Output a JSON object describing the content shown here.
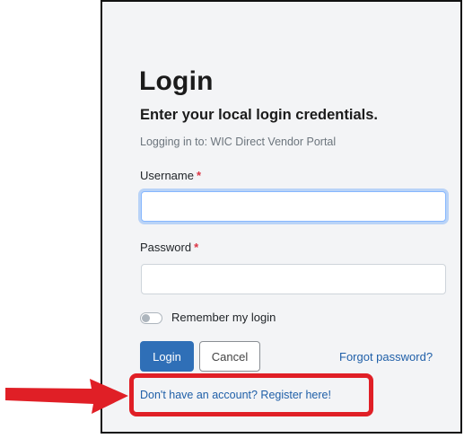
{
  "login": {
    "title": "Login",
    "subtitle": "Enter your local login credentials.",
    "logging_in_to": "Logging in to: WIC Direct Vendor Portal",
    "username_label": "Username",
    "password_label": "Password",
    "required_marker": "*",
    "username_value": "",
    "password_value": "",
    "remember_label": "Remember my login",
    "remember_checked": false,
    "login_button": "Login",
    "cancel_button": "Cancel",
    "forgot_link": "Forgot password?",
    "register_link": "Don't have an account? Register here!"
  },
  "colors": {
    "primary": "#2f6fb7",
    "link": "#1f5fa8",
    "required": "#dc3545",
    "highlight": "#e01f26"
  }
}
